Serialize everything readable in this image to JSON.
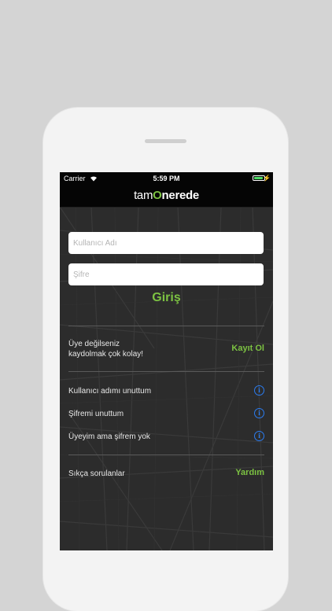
{
  "status_bar": {
    "carrier": "Carrier",
    "time": "5:59 PM",
    "battery_level": 0.9
  },
  "header": {
    "logo_tam": "tam",
    "logo_o": "O",
    "logo_nerede": "nerede"
  },
  "login_form": {
    "username_placeholder": "Kullanıcı Adı",
    "password_placeholder": "Şifre",
    "login_label": "Giriş"
  },
  "register": {
    "line1": "Üye değilseniz",
    "line2": "kaydolmak çok kolay!",
    "action_label": "Kayıt Ol"
  },
  "help_links": [
    {
      "label": "Kullanıcı adımı unuttum"
    },
    {
      "label": "Şifremi unuttum"
    },
    {
      "label": "Üyeyim ama şifrem yok"
    }
  ],
  "faq": {
    "label": "Sıkça sorulanlar",
    "action_label": "Yardım"
  },
  "colors": {
    "accent": "#7cc242",
    "info": "#2b7cf0",
    "background": "#2c2c2c"
  }
}
